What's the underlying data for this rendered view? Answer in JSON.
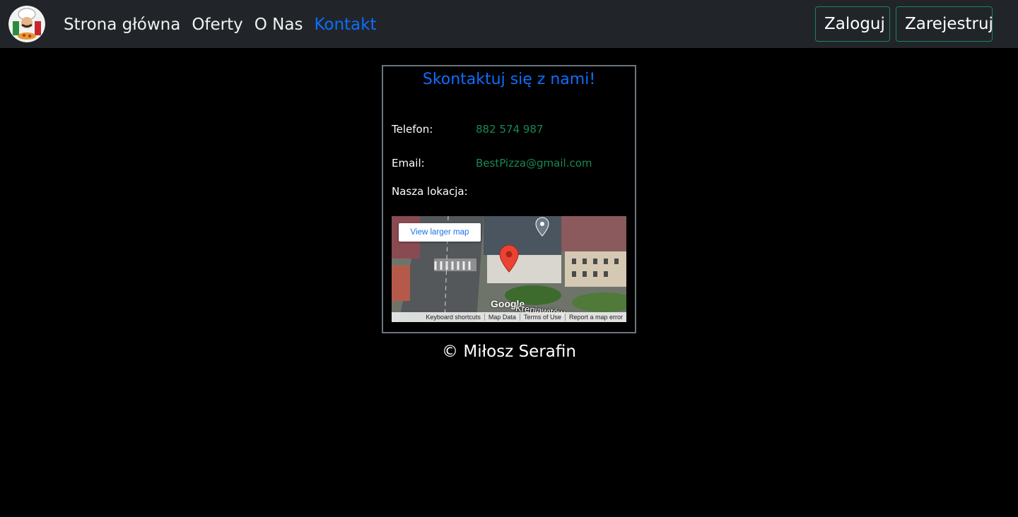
{
  "nav": {
    "links": [
      {
        "label": "Strona główna"
      },
      {
        "label": "Oferty"
      },
      {
        "label": "O Nas"
      },
      {
        "label": "Kontakt"
      }
    ],
    "login": "Zaloguj",
    "register": "Zarejestruj"
  },
  "contact": {
    "title": "Skontaktuj się z nami!",
    "phone_label": "Telefon:",
    "phone_value": "882 574 987",
    "email_label": "Email:",
    "email_value": "BestPizza@gmail.com",
    "location_label": "Nasza lokacja:"
  },
  "map": {
    "view_larger": "View larger map",
    "street": "Kreniawitów",
    "google": "Google",
    "footer_links": [
      "Keyboard shortcuts",
      "Map Data",
      "Terms of Use",
      "Report a map error"
    ]
  },
  "footer": {
    "text": "© Miłosz Serafin"
  },
  "colors": {
    "accent": "#0d6efd",
    "success": "#198754",
    "navbar": "#212529"
  }
}
